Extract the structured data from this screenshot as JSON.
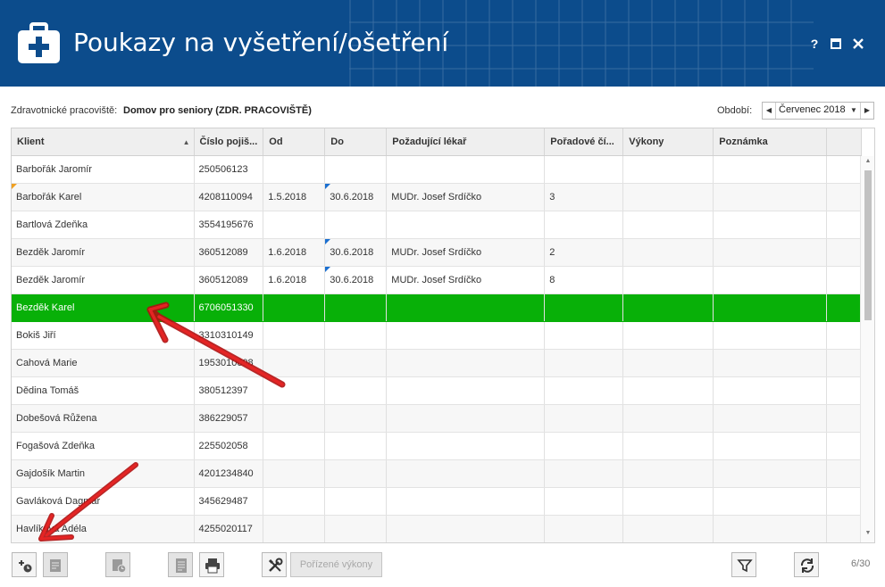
{
  "window": {
    "title": "Poukazy na vyšetření/ošetření",
    "help_label": "?",
    "maximize_label": "■",
    "close_label": "✕"
  },
  "filters": {
    "workplace_label": "Zdravotnické pracoviště:",
    "workplace_value": "Domov pro seniory (ZDR. PRACOVIŠTĚ)",
    "period_label": "Období:",
    "period_value": "Červenec 2018"
  },
  "table": {
    "columns": [
      "Klient",
      "Číslo pojiš...",
      "Od",
      "Do",
      "Požadující lékař",
      "Pořadové čí...",
      "Výkony",
      "Poznámka"
    ],
    "rows": [
      {
        "klient": "Barbořák Jaromír",
        "cislo": "250506123",
        "od": "",
        "do": "",
        "lekar": "",
        "poradove": "",
        "vykony": "",
        "poznamka": ""
      },
      {
        "klient": "Barbořák Karel",
        "cislo": "4208110094",
        "od": "1.5.2018",
        "do": "30.6.2018",
        "lekar": "MUDr. Josef Srdíčko",
        "poradove": "3",
        "vykony": "",
        "poznamka": ""
      },
      {
        "klient": "Bartlová Zdeňka",
        "cislo": "3554195676",
        "od": "",
        "do": "",
        "lekar": "",
        "poradove": "",
        "vykony": "",
        "poznamka": ""
      },
      {
        "klient": "Bezděk Jaromír",
        "cislo": "360512089",
        "od": "1.6.2018",
        "do": "30.6.2018",
        "lekar": "MUDr. Josef Srdíčko",
        "poradove": "2",
        "vykony": "",
        "poznamka": ""
      },
      {
        "klient": "Bezděk Jaromír",
        "cislo": "360512089",
        "od": "1.6.2018",
        "do": "30.6.2018",
        "lekar": "MUDr. Josef Srdíčko",
        "poradove": "8",
        "vykony": "",
        "poznamka": ""
      },
      {
        "klient": "Bezděk Karel",
        "cislo": "6706051330",
        "od": "",
        "do": "",
        "lekar": "",
        "poradove": "",
        "vykony": "",
        "poznamka": ""
      },
      {
        "klient": "Bokiš Jiří",
        "cislo": "3310310149",
        "od": "",
        "do": "",
        "lekar": "",
        "poradove": "",
        "vykony": "",
        "poznamka": ""
      },
      {
        "klient": "Cahová Marie",
        "cislo": "1953010008",
        "od": "",
        "do": "",
        "lekar": "",
        "poradove": "",
        "vykony": "",
        "poznamka": ""
      },
      {
        "klient": "Dědina Tomáš",
        "cislo": "380512397",
        "od": "",
        "do": "",
        "lekar": "",
        "poradove": "",
        "vykony": "",
        "poznamka": ""
      },
      {
        "klient": "Dobešová Růžena",
        "cislo": "386229057",
        "od": "",
        "do": "",
        "lekar": "",
        "poradove": "",
        "vykony": "",
        "poznamka": ""
      },
      {
        "klient": "Fogašová Zdeňka",
        "cislo": "225502058",
        "od": "",
        "do": "",
        "lekar": "",
        "poradove": "",
        "vykony": "",
        "poznamka": ""
      },
      {
        "klient": "Gajdošík Martin",
        "cislo": "4201234840",
        "od": "",
        "do": "",
        "lekar": "",
        "poradove": "",
        "vykony": "",
        "poznamka": ""
      },
      {
        "klient": "Gavláková Dagmar",
        "cislo": "345629487",
        "od": "",
        "do": "",
        "lekar": "",
        "poradove": "",
        "vykony": "",
        "poznamka": ""
      },
      {
        "klient": "Havlíková Adéla",
        "cislo": "4255020117",
        "od": "",
        "do": "",
        "lekar": "",
        "poradove": "",
        "vykony": "",
        "poznamka": ""
      }
    ],
    "selected_row": 5,
    "selected_color": "#08b008"
  },
  "toolbar": {
    "performed_label": "Pořízené výkony",
    "page_info": "6/30"
  },
  "colors": {
    "header_bg": "#0c4c8c",
    "annotation_arrow": "#d01818"
  }
}
